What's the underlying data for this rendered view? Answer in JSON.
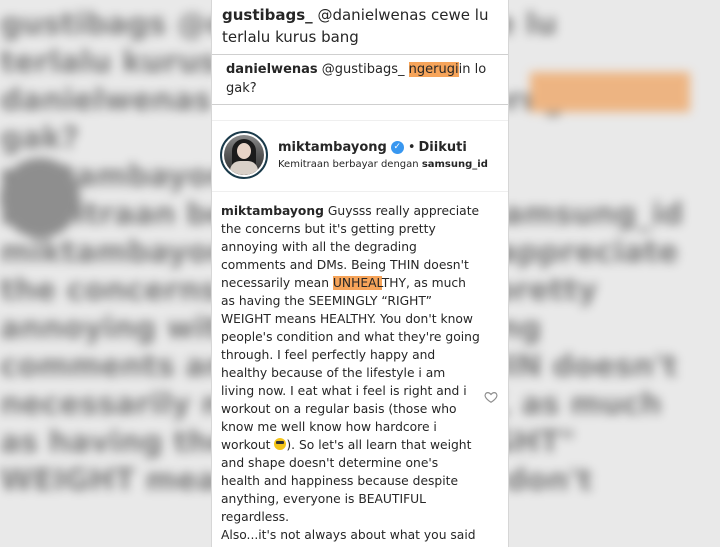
{
  "background_text": [
    "gustibags  @danielwenas cewe lu",
    "terlalu kurus bang",
    "danielwenas @gustibags_ ngerugiin lo",
    "gak?",
    "",
    "miktambayong • Diikuti",
    "Kemitraan berbayar dengan samsung_id",
    "miktambayong Guysss really appreciate",
    "the concerns but it's getting pretty",
    "annoying with all the degrading",
    "comments and DMs. Being THIN doesn't",
    "necessarily mean UNHEALTHY, as much",
    "as having the SEEMINGLY \"RIGHT\"",
    "WEIGHT means HEALTHY. You don't"
  ],
  "comments": [
    {
      "username": "gustibags_",
      "text": "@danielwenas cewe lu terlalu kurus bang"
    },
    {
      "username": "danielwenas",
      "mention": "@gustibags_",
      "highlight": "ngerugi",
      "rest": "in lo gak?"
    }
  ],
  "post": {
    "username": "miktambayong",
    "verified_glyph": "✓",
    "separator": "•",
    "follow_status": "Diikuti",
    "partnership_prefix": "Kemitraan berbayar dengan",
    "partner": "samsung_id"
  },
  "caption": {
    "username": "miktambayong",
    "part1": "Guysss really appreciate the concerns but it's getting pretty annoying with all the degrading comments and DMs. Being THIN doesn't necessarily mean ",
    "highlight": "UNHEAL",
    "part2": "THY, as much as having the SEEMINGLY “RIGHT” WEIGHT means HEALTHY. You don't know people's condition and what they're going through. I feel perfectly happy and healthy because of the lifestyle i am living now. I eat what i feel is right and i workout on a regular basis (those who know me well know how hardcore i workout ",
    "part3": "). So let's all learn that weight and shape doesn't determine one's health and happiness because despite anything, everyone is BEAUTIFUL regardless.",
    "part4": "Also...it's not always about what you said but HOW you say it. So when you want"
  },
  "colors": {
    "highlight": "#f6a45a",
    "verified": "#3897f0",
    "text": "#262626"
  },
  "icons": [
    "heart-icon",
    "verified-icon",
    "emoji-icon"
  ]
}
